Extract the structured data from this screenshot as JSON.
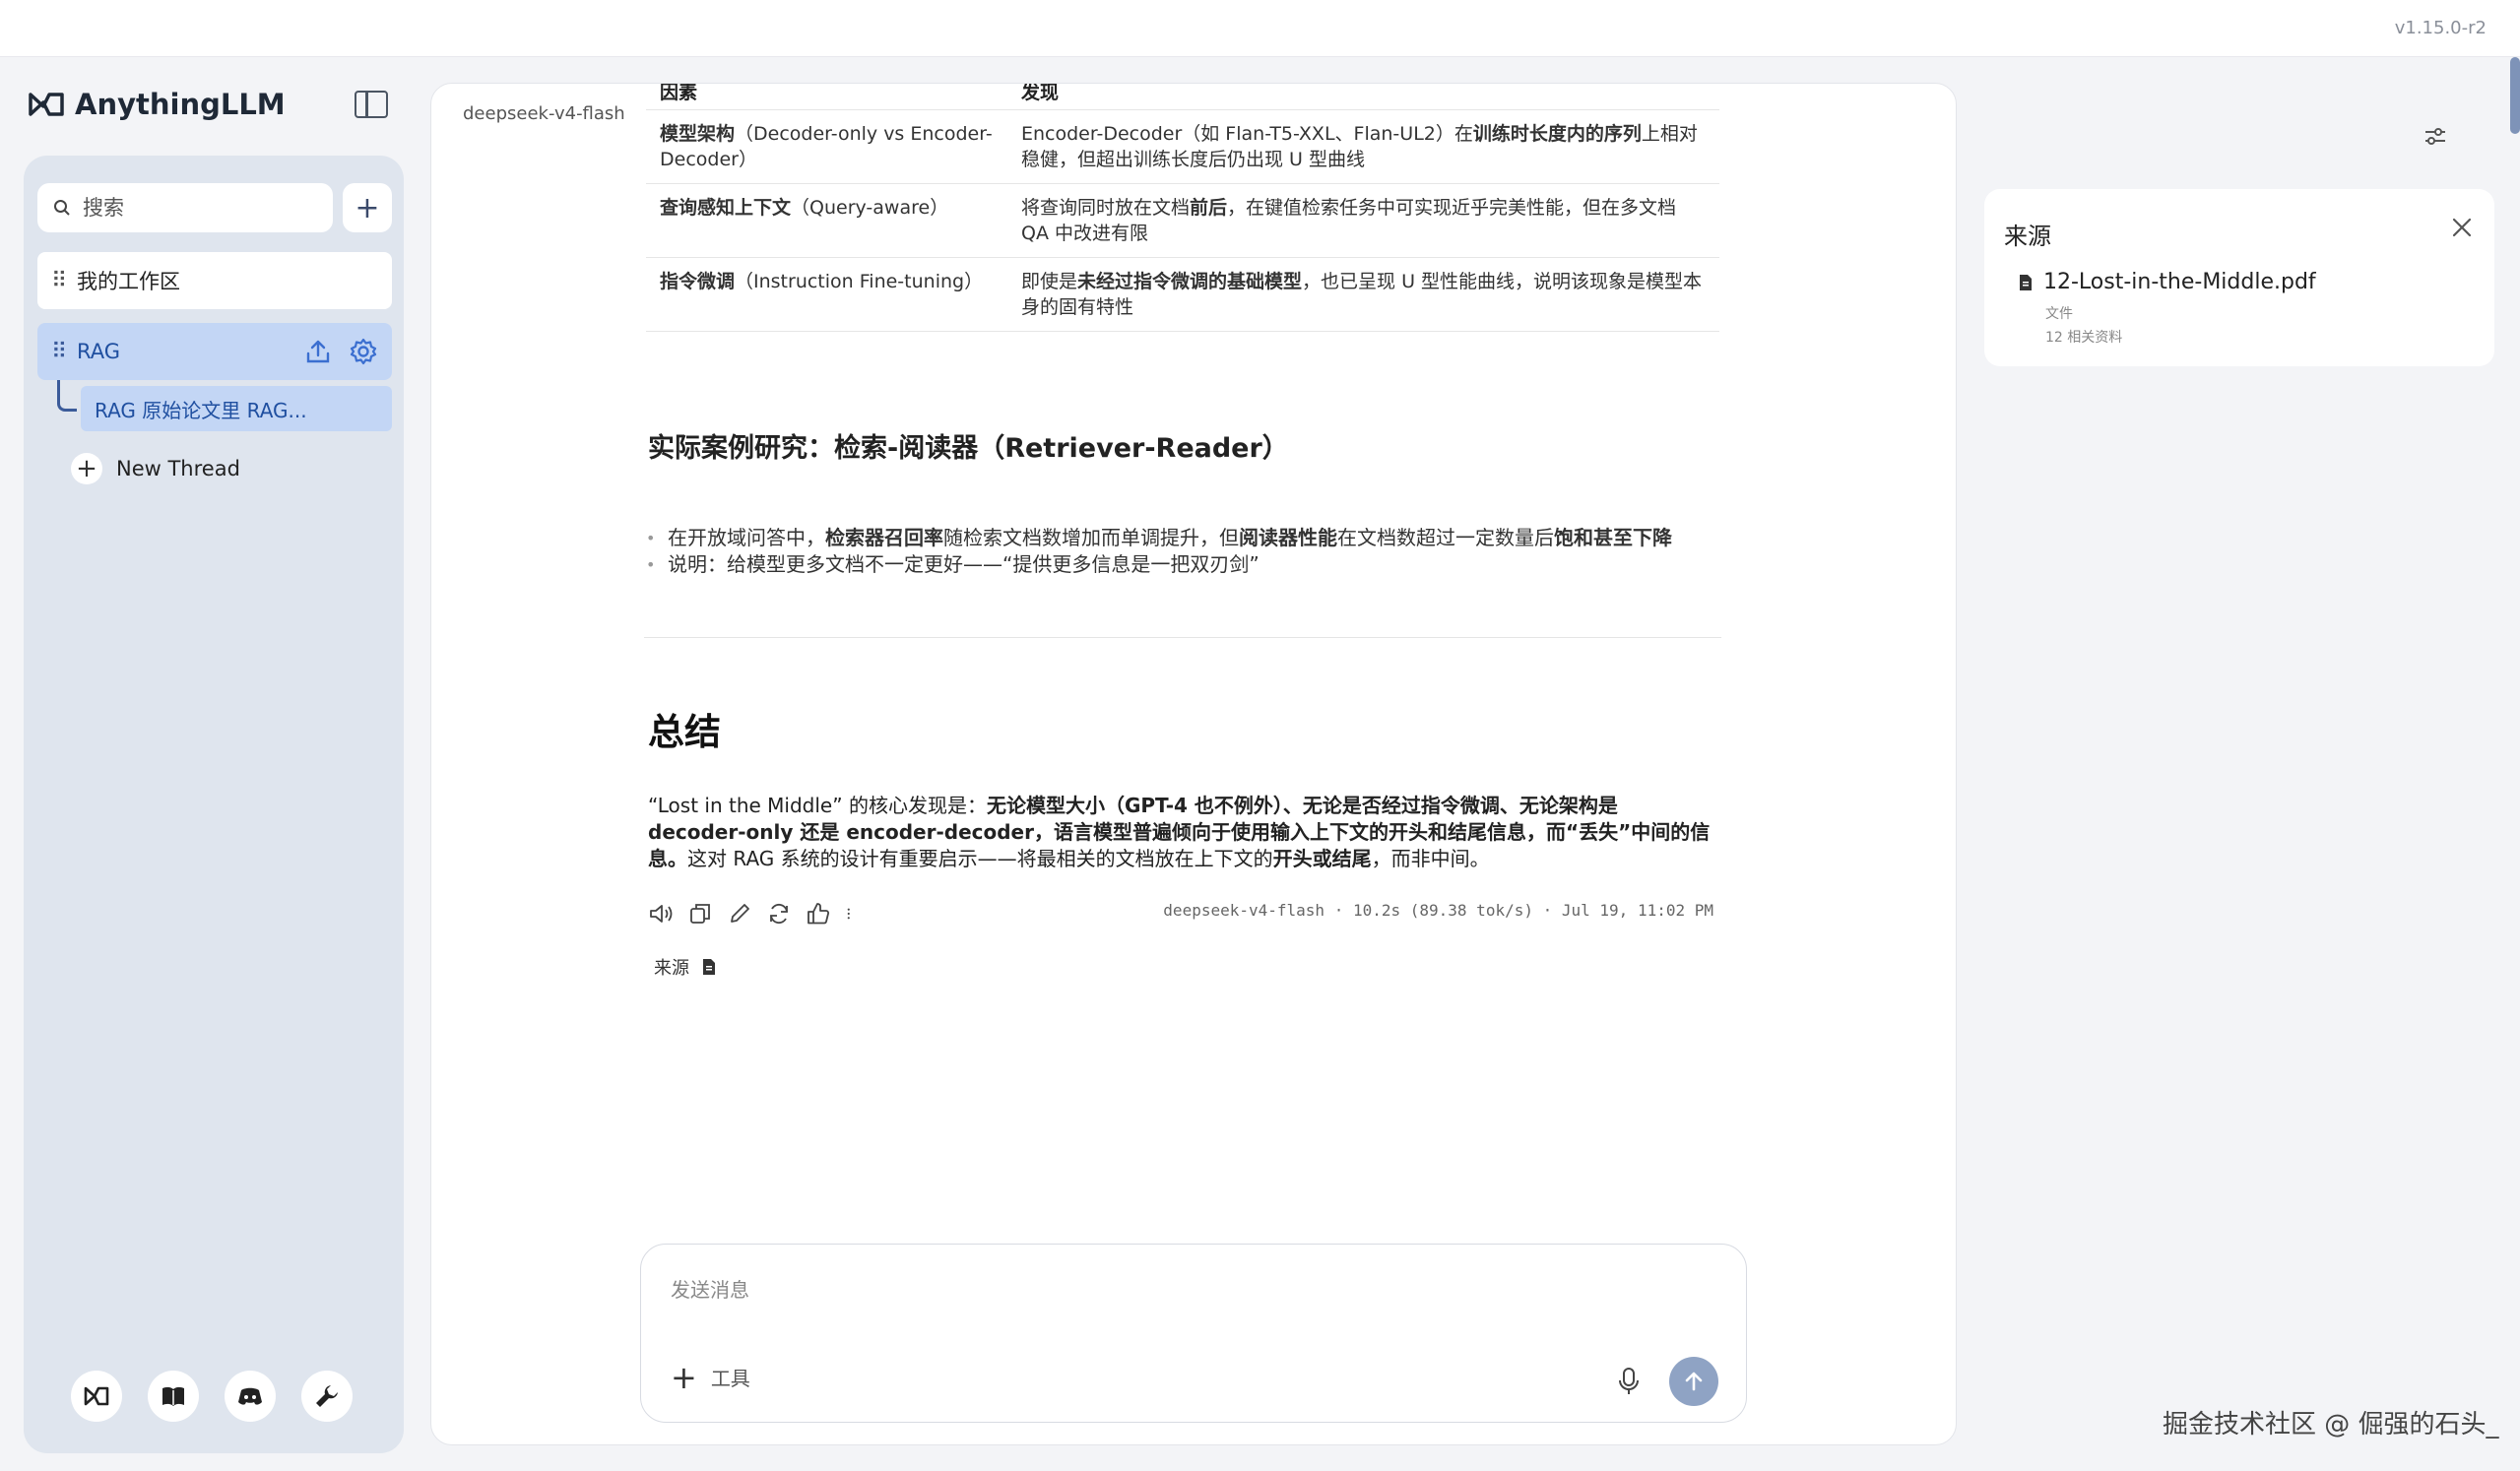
{
  "app": {
    "name": "AnythingLLM",
    "version": "v1.15.0-r2"
  },
  "sidebar": {
    "search_placeholder": "搜索",
    "workspaces": [
      {
        "label": "我的工作区"
      },
      {
        "label": "RAG"
      }
    ],
    "thread_label": "RAG 原始论文里 RAG...",
    "new_thread_label": "New Thread"
  },
  "chat": {
    "model_tag": "deepseek-v4-flash",
    "table": {
      "headers": [
        "因素",
        "发现"
      ],
      "rows": [
        {
          "factor": "模型架构",
          "factor_suffix": "（Decoder-only vs Encoder-Decoder）",
          "finding_a": "Encoder-Decoder（如 Flan-T5-XXL、Flan-UL2）在",
          "finding_bold": "训练时长度内的序列",
          "finding_b": "上相对稳健，但超出训练长度后仍出现 U 型曲线"
        },
        {
          "factor": "查询感知上下文",
          "factor_suffix": "（Query-aware）",
          "finding_a": "将查询同时放在文档",
          "finding_bold": "前后",
          "finding_b": "，在键值检索任务中可实现近乎完美性能，但在多文档 QA 中改进有限"
        },
        {
          "factor": "指令微调",
          "factor_suffix": "（Instruction Fine-tuning）",
          "finding_a": "即使是",
          "finding_bold": "未经过指令微调的基础模型",
          "finding_b": "，也已呈现 U 型性能曲线，说明该现象是模型本身的固有特性"
        }
      ]
    },
    "case_heading": "实际案例研究：检索-阅读器（Retriever-Reader）",
    "bullet1": {
      "a": "在开放域问答中，",
      "b": "检索器召回率",
      "c": "随检索文档数增加而单调提升，但",
      "d": "阅读器性能",
      "e": "在文档数超过一定数量后",
      "f": "饱和甚至下降"
    },
    "bullet2": "说明：给模型更多文档不一定更好——“提供更多信息是一把双刃剑”",
    "summary_heading": "总结",
    "summary": {
      "a": "“Lost in the Middle” 的核心发现是：",
      "b": "无论模型大小（GPT-4 也不例外）、无论是否经过指令微调、无论架构是 decoder-only 还是 encoder-decoder，语言模型普遍倾向于使用输入上下文的开头和结尾信息，而“丢失”中间的信息。",
      "c": "这对 RAG 系统的设计有重要启示——将最相关的文档放在上下文的",
      "d": "开头或结尾",
      "e": "，而非中间。"
    },
    "meta": "deepseek-v4-flash · 10.2s (89.38 tok/s) · Jul 19, 11:02 PM",
    "sources_label": "来源",
    "composer_placeholder": "发送消息",
    "tools_label": "工具"
  },
  "sources_panel": {
    "title": "来源",
    "file_name": "12-Lost-in-the-Middle.pdf",
    "file_type": "文件",
    "file_refs": "12 相关资料"
  },
  "watermark": "掘金技术社区 @ 倔强的石头_",
  "colors": {
    "accent": "#1f4fa0",
    "selected_bg": "#c3d6f5",
    "sidebar_bg": "#dfe5ee",
    "send_button": "#8fa3c4"
  }
}
